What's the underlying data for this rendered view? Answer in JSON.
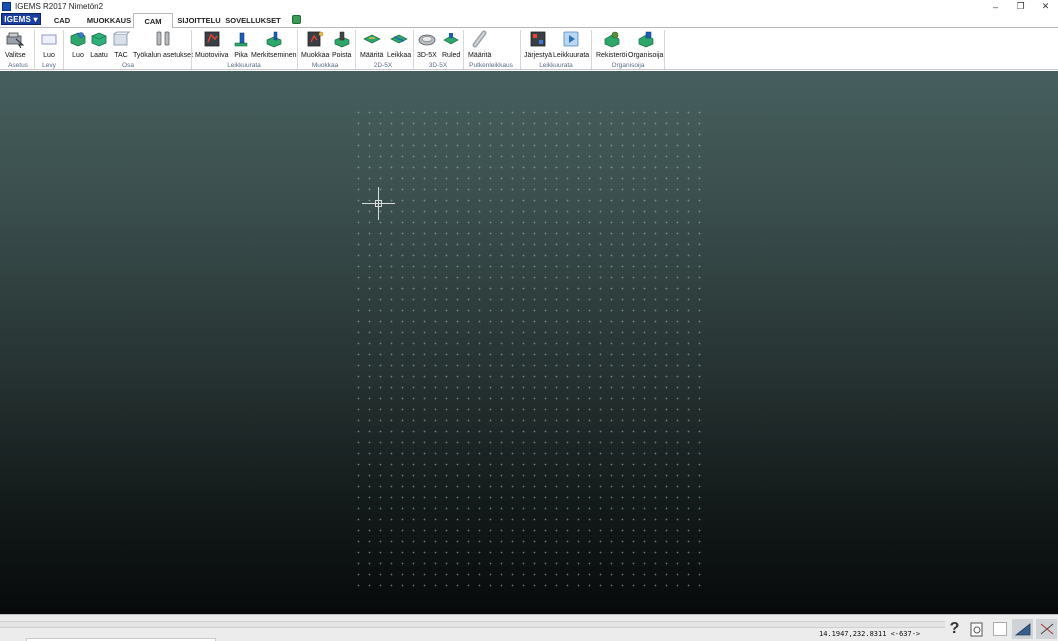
{
  "window": {
    "title": "IGEMS R2017  Nimetön2",
    "controls": {
      "minimize": "–",
      "restore": "❐",
      "close": "✕"
    }
  },
  "tabs": {
    "app_menu": "IGEMS ▾",
    "items": [
      "CAD",
      "MUOKKAUS",
      "CAM",
      "SIJOITTELU",
      "SOVELLUKSET"
    ],
    "active": "CAM"
  },
  "ribbon": {
    "buttons": {
      "valitse": "Valitse",
      "levy_luo": "Luo",
      "osa_luo": "Luo",
      "laatu": "Laatu",
      "tac": "TAC",
      "tyokalun_asetukset": "Työkalun asetukset",
      "muotoviiva": "Muotoviiva",
      "pika": "Pika",
      "merkitseminen": "Merkitseminen",
      "muokkaa": "Muokkaa",
      "poista": "Poista",
      "maarita_2d": "Määritä",
      "leikkaa": "Leikkaa",
      "b3d5x": "3D-5X",
      "ruled": "Ruled",
      "maarita_putki": "Määritä",
      "jarjestya": "Järjestyä",
      "leikkuurata": "Leikkuurata",
      "rekisteroi": "Rekisteröi",
      "organisoija": "Organisoija"
    },
    "groups": {
      "asetus": "Asetus",
      "levy": "Levy",
      "osa": "Osa",
      "leikkuurata": "Leikkuurata",
      "muokkaa": "Muokkaa",
      "g2d5x": "2D-5X",
      "g3d5x": "3D-5X",
      "putkenleikkaus": "Putkenleikkaus",
      "leikkuurata2": "Leikkuurata",
      "organisoija": "Organisoija"
    }
  },
  "status": {
    "coordinates": "14.1947,232.8311 <-637->",
    "help": "?"
  },
  "colors": {
    "app_button": "#1b3f9c",
    "canvas_top": "#465f5e",
    "canvas_bottom": "#070a0a",
    "group_label": "#5a6a86"
  }
}
